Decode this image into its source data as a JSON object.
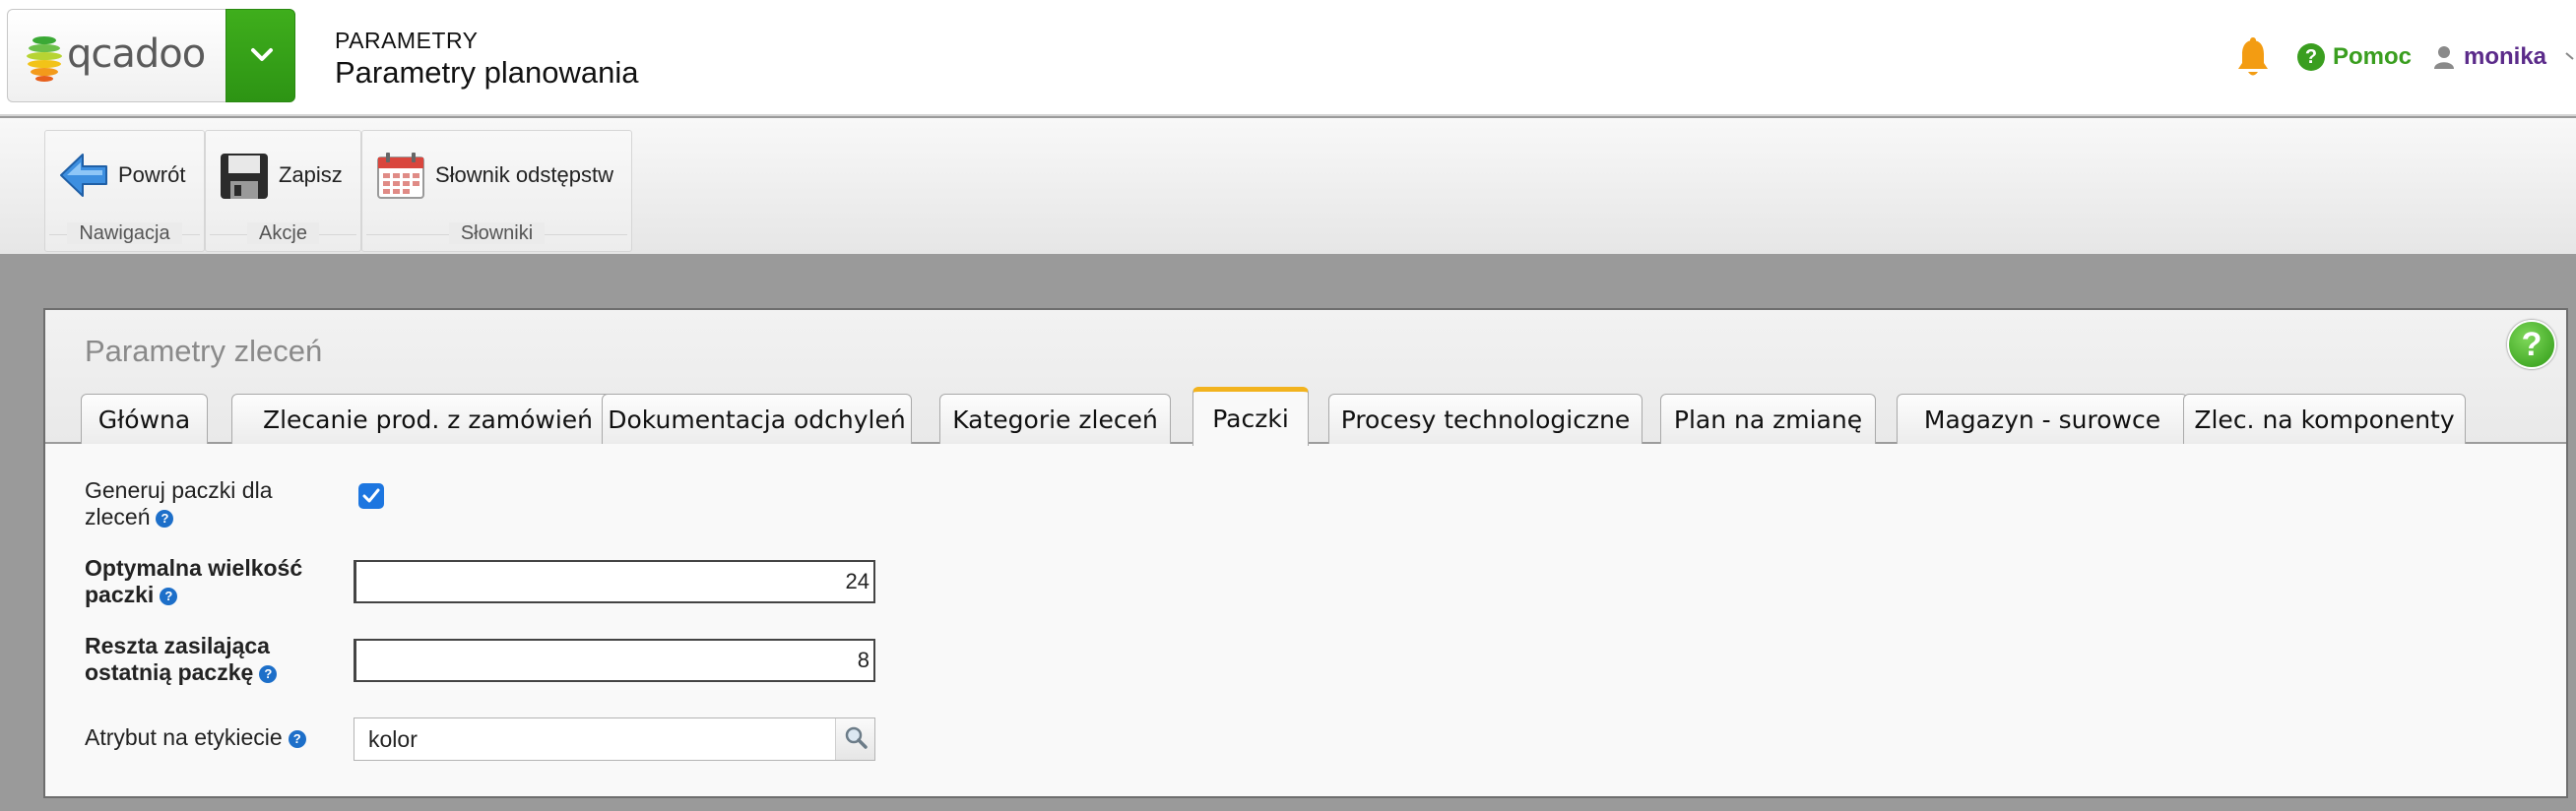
{
  "header": {
    "logo_text": "qcadoo",
    "crumb_top": "PARAMETRY",
    "crumb_title": "Parametry planowania",
    "help_label": "Pomoc",
    "user_name": "monika",
    "icons": {
      "menu_toggle": "chevron-down-icon",
      "notifications": "bell-icon",
      "help": "question-circle-icon",
      "user": "user-icon"
    },
    "colors": {
      "brand_green": "#2d9414",
      "bell": "#f39c12",
      "user": "#5b2b8a"
    }
  },
  "ribbon": {
    "groups": [
      {
        "label": "Nawigacja",
        "items": [
          {
            "label": "Powrót",
            "icon": "back-arrow-icon"
          }
        ]
      },
      {
        "label": "Akcje",
        "items": [
          {
            "label": "Zapisz",
            "icon": "save-icon"
          }
        ]
      },
      {
        "label": "Słowniki",
        "items": [
          {
            "label": "Słownik odstępstw",
            "icon": "calendar-icon"
          }
        ]
      }
    ]
  },
  "window": {
    "title": "Parametry zleceń",
    "help_glyph": "?",
    "tabs": [
      {
        "label": "Główna",
        "active": false
      },
      {
        "label": "Zlecanie prod. z zamówień",
        "active": false
      },
      {
        "label": "Dokumentacja odchyleń",
        "active": false
      },
      {
        "label": "Kategorie zleceń",
        "active": false
      },
      {
        "label": "Paczki",
        "active": true
      },
      {
        "label": "Procesy technologiczne",
        "active": false
      },
      {
        "label": "Plan na zmianę",
        "active": false
      },
      {
        "label": "Magazyn - surowce",
        "active": false
      },
      {
        "label": "Zlec. na komponenty",
        "active": false
      }
    ],
    "accent_color": "#f2b31e"
  },
  "form": {
    "generate": {
      "label_line1": "Generuj paczki dla",
      "label_line2": "zleceń",
      "checked": true
    },
    "optimal_size": {
      "label_line1": "Optymalna wielkość",
      "label_line2": "paczki",
      "value": "24"
    },
    "remainder": {
      "label_line1": "Reszta zasilająca",
      "label_line2": "ostatnią paczkę",
      "value": "8"
    },
    "label_attribute": {
      "label": "Atrybut na etykiecie",
      "value": "kolor",
      "icon": "search-icon"
    },
    "help_glyph": "?"
  }
}
